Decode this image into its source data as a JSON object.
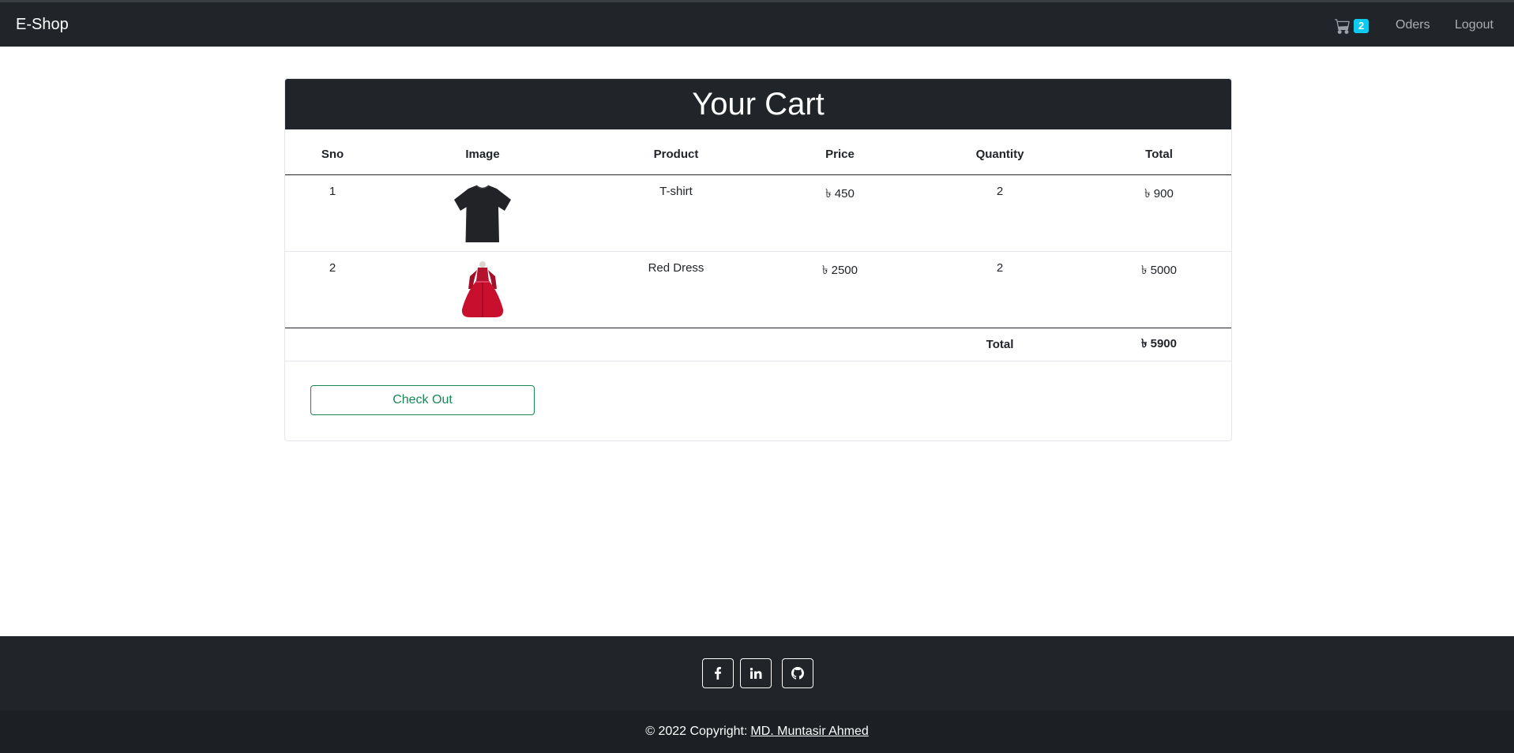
{
  "nav": {
    "brand": "E-Shop",
    "cart_count": "2",
    "orders_label": "Oders",
    "logout_label": "Logout"
  },
  "cart": {
    "title": "Your Cart",
    "headers": {
      "sno": "Sno",
      "image": "Image",
      "product": "Product",
      "price": "Price",
      "quantity": "Quantity",
      "total": "Total"
    },
    "items": [
      {
        "sno": "1",
        "image": "black-tshirt-image",
        "product": "T-shirt",
        "price": "৳ 450",
        "quantity": "2",
        "total": "৳ 900"
      },
      {
        "sno": "2",
        "image": "red-dress-image",
        "product": "Red Dress",
        "price": "৳ 2500",
        "quantity": "2",
        "total": "৳ 5000"
      }
    ],
    "total_label": "Total",
    "grand_total": "৳ 5900",
    "checkout_label": "Check Out"
  },
  "footer": {
    "social": [
      "facebook-icon",
      "linkedin-icon",
      "github-icon"
    ],
    "copyright_prefix": "© 2022 Copyright:",
    "copyright_name": "MD. Muntasir Ahmed"
  },
  "colors": {
    "navbar": "#212529",
    "badge": "#0dcaf0",
    "checkout": "#198754"
  }
}
